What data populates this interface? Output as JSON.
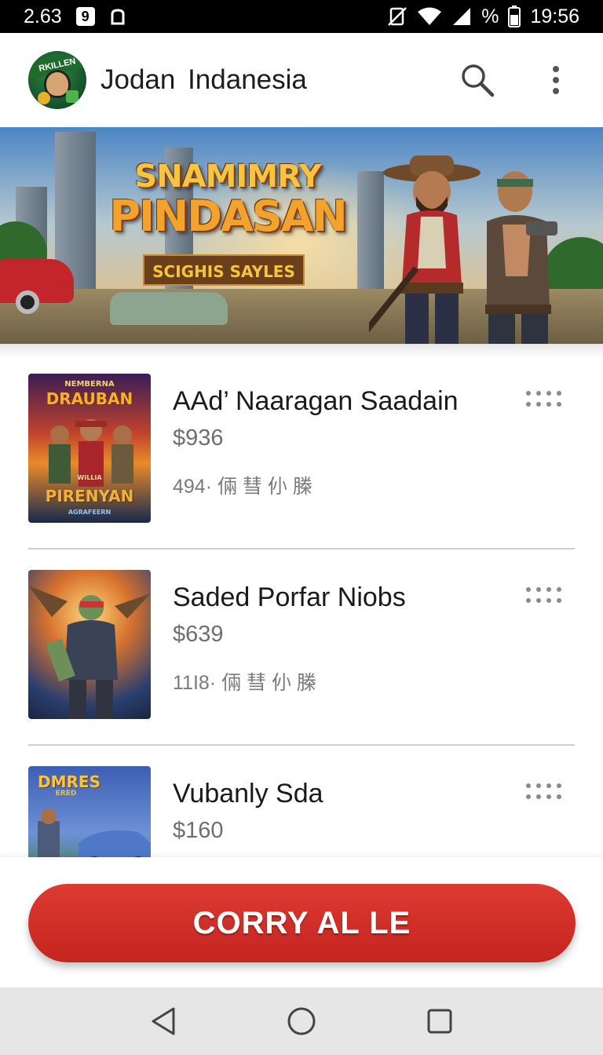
{
  "status_bar": {
    "left_time": "2.63",
    "badge_label": "9",
    "battery_label": "%",
    "clock": "19:56"
  },
  "app_bar": {
    "logo_text": "RKILLEN",
    "title": "Jodan Indanesia",
    "search_icon": "search-icon",
    "menu_icon": "overflow-menu-icon"
  },
  "banner": {
    "title_line1": "SNAMIMRY",
    "title_line2": "PINDASAN",
    "subtitle": "SCIGHIS SAYLES"
  },
  "items": [
    {
      "title": "AAd’ Naaragan Saadain",
      "price": "$936",
      "meta": "494· 倆 彗 仦 榺",
      "poster_top": "NEMBERNA",
      "poster_head": "DRAUBAN",
      "poster_bottom": "PIRENYAN",
      "poster_small": "AGRAFEERN",
      "poster_mid": "WILLIA"
    },
    {
      "title": "Saded Porfar Niobs",
      "price": "$639",
      "meta": "11I8· 倆 彗 仦 榺"
    },
    {
      "title": "Vubanly Sda",
      "price": "$160",
      "poster_head": "DMRES",
      "poster_sub": "ERED"
    }
  ],
  "cta": {
    "label": "CORRY AL LE"
  },
  "colors": {
    "accent": "#d3302a",
    "status_bar": "#000000",
    "nav_bar": "#e6e6e6"
  }
}
